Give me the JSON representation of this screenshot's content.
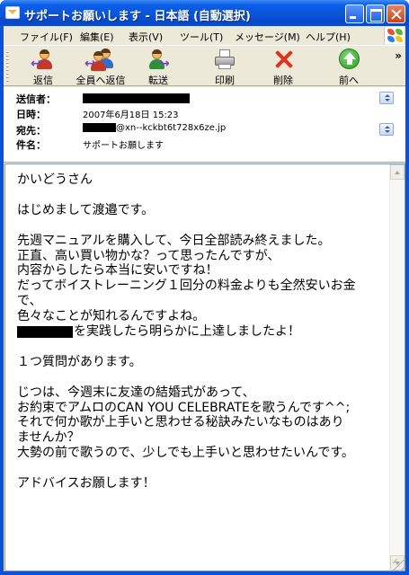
{
  "window": {
    "title": "サポートお願いします - 日本語 (自動選択)"
  },
  "menu": [
    {
      "label": "ファイル(F)"
    },
    {
      "label": "編集(E)"
    },
    {
      "label": "表示(V)"
    },
    {
      "label": "ツール(T)"
    },
    {
      "label": "メッセージ(M)"
    },
    {
      "label": "ヘルプ(H)"
    }
  ],
  "toolbar": {
    "reply": "返信",
    "reply_all": "全員へ返信",
    "forward": "転送",
    "print": "印刷",
    "delete": "削除",
    "previous": "前へ",
    "overflow": "»"
  },
  "header": {
    "from_label": "送信者：",
    "date_label": "日時：",
    "date_value": "2007年6月18日 15:23",
    "to_label": "宛先：",
    "to_value": "@xn--kckbt6t728x6ze.jp",
    "subject_label": "件名：",
    "subject_value": "サポートお願します"
  },
  "body": {
    "lines": [
      "かいどうさん",
      "",
      "はじめまして渡邉です。",
      "",
      "先週マニュアルを購入して、今日全部読み終えました。",
      "正直、高い買い物かな？って思ったんですが、",
      "内容からしたら本当に安いですね！",
      "だってボイストレーニング１回分の料金よりも全然安いお金",
      "で、",
      "色々なことが知れるんですよね。",
      "を実践したら明らかに上達しましたよ！",
      "",
      "１つ質問があります。",
      "",
      "じつは、今週末に友達の結婚式があって、",
      "お約束でアムロのCAN YOU CELEBRATEを歌うんです^^;",
      "それで何か歌が上手いと思わせる秘訣みたいなものはあり",
      "ませんか？",
      "大勢の前で歌うので、少しでも上手いと思わせたいんです。",
      "",
      "アドバイスお願します！"
    ]
  },
  "colors": {
    "titlebar": "#0a55db",
    "chrome": "#ece9d8",
    "delete_x": "#e0321b",
    "previous_arrow": "#3aa23a"
  },
  "icons": {
    "reply": "person-reply-icon",
    "reply_all": "people-reply-all-icon",
    "forward": "person-forward-icon",
    "print": "printer-icon",
    "delete": "red-x-icon",
    "previous": "green-up-arrow-icon"
  }
}
